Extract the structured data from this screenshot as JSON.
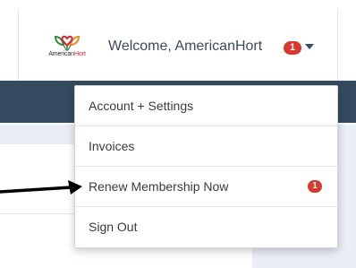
{
  "header": {
    "logo": {
      "name": "americanhort-logo-icon",
      "text_part1": "American",
      "text_part2": "Hort"
    },
    "welcome_text": "Welcome, AmericanHort",
    "notification_count": "1",
    "caret_icon": "caret-down-icon"
  },
  "dropdown": {
    "items": [
      {
        "label": "Account + Settings",
        "badge": ""
      },
      {
        "label": "Invoices",
        "badge": ""
      },
      {
        "label": "Renew Membership Now",
        "badge": "1"
      },
      {
        "label": "Sign Out",
        "badge": ""
      }
    ]
  },
  "annotation": {
    "arrow_icon": "arrow-right-icon"
  },
  "colors": {
    "nav_band": "#344a5e",
    "badge_red": "#d9392e",
    "welcome_text": "#3a4b5f",
    "logo_green": "#2f8a3e",
    "logo_red": "#d2262f",
    "logo_orange": "#f08a1c"
  }
}
